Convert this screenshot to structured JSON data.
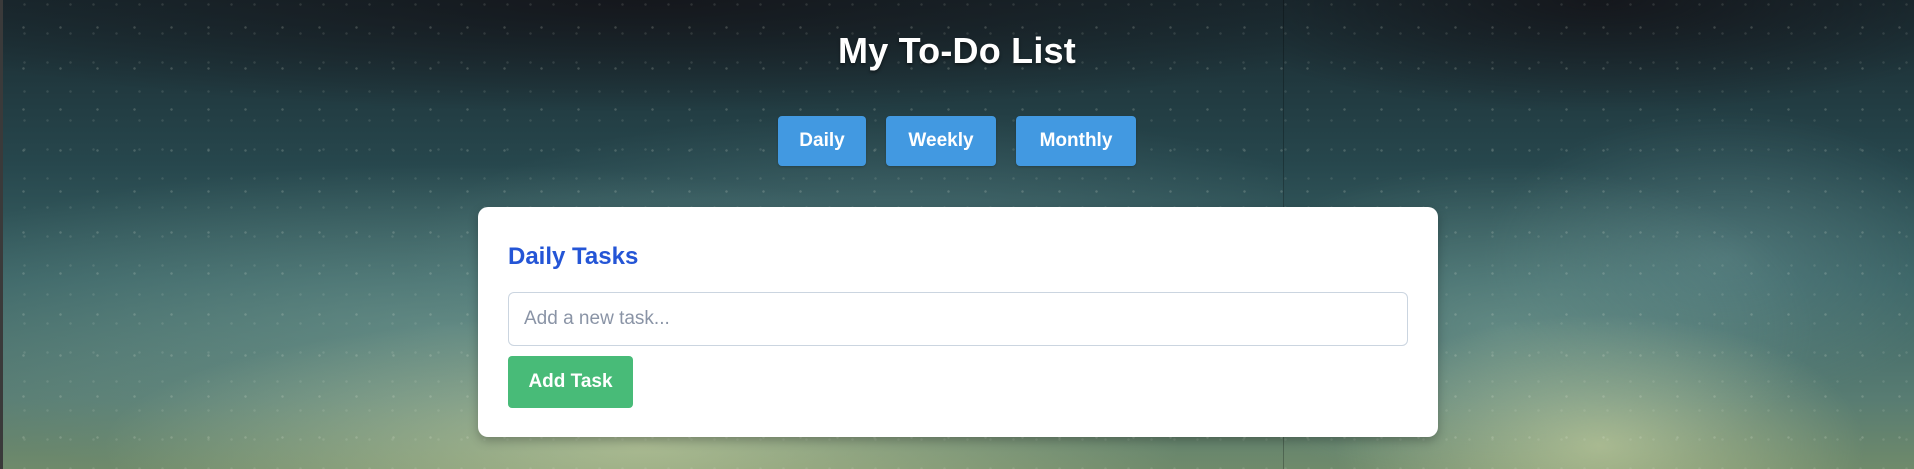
{
  "header": {
    "title": "My To-Do List"
  },
  "tabs": [
    {
      "label": "Daily",
      "active": true
    },
    {
      "label": "Weekly",
      "active": false
    },
    {
      "label": "Monthly",
      "active": false
    }
  ],
  "card": {
    "title": "Daily Tasks",
    "input": {
      "placeholder": "Add a new task...",
      "value": ""
    },
    "add_button_label": "Add Task"
  },
  "colors": {
    "tab_blue": "#4299e1",
    "title_blue": "#2455d6",
    "add_green": "#48bb78",
    "card_bg": "#ffffff"
  }
}
